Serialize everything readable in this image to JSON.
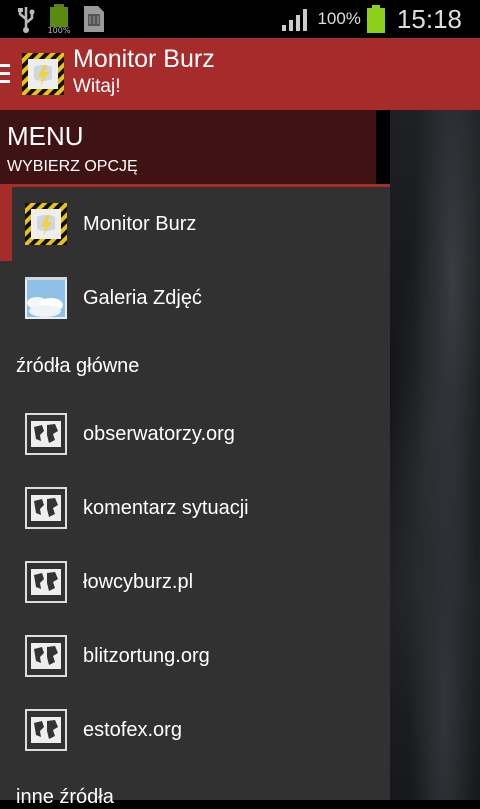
{
  "status_bar": {
    "battery_percent": "100%",
    "time": "15:18",
    "left_icons": [
      "usb-icon",
      "battery-charging-icon",
      "sim-card-icon"
    ],
    "right_icons": [
      "signal-icon",
      "battery-icon"
    ]
  },
  "action_bar": {
    "title": "Monitor Burz",
    "subtitle": "Witaj!",
    "accent_color": "#a62b2b"
  },
  "drawer": {
    "header_title": "MENU",
    "header_subtitle": "WYBIERZ OPCJĘ",
    "items": [
      {
        "label": "Monitor Burz",
        "icon": "storm-monitor-icon",
        "active": true
      },
      {
        "label": "Galeria Zdjęć",
        "icon": "gallery-icon",
        "active": false
      }
    ],
    "section_main": "źródła główne",
    "sources": [
      {
        "label": "obserwatorzy.org",
        "icon": "map-icon"
      },
      {
        "label": "komentarz sytuacji",
        "icon": "map-icon"
      },
      {
        "label": "łowcyburz.pl",
        "icon": "map-icon"
      },
      {
        "label": "blitzortung.org",
        "icon": "map-icon"
      },
      {
        "label": "estofex.org",
        "icon": "map-icon"
      }
    ],
    "section_other": "inne źródła"
  }
}
